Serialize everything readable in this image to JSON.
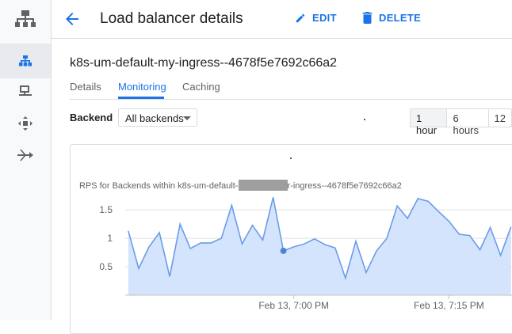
{
  "header": {
    "title": "Load balancer details",
    "edit_label": "EDIT",
    "delete_label": "DELETE"
  },
  "lb_name": "k8s-um-default-my-ingress--4678f5e7692c66a2",
  "tabs": [
    "Details",
    "Monitoring",
    "Caching"
  ],
  "active_tab": "Monitoring",
  "filters": {
    "backend_label": "Backend",
    "backend_value": "All backends"
  },
  "time_ranges": [
    "1 hour",
    "6 hours",
    "12"
  ],
  "selected_range": "1 hour",
  "rail_icons": [
    "network-services-icon",
    "load-balancing-icon",
    "backends-icon",
    "cloud-dns-icon",
    "cloud-nat-icon"
  ],
  "colors": {
    "accent": "#1a73e8",
    "series_line": "#6b9ce8",
    "series_fill": "#d2e3fc"
  },
  "chart_data": {
    "type": "area",
    "title_prefix": "RPS for Backends within k8s-um-default-",
    "title_suffix": "r-ingress--4678f5e7692c66a2",
    "xlabel": "",
    "ylabel": "",
    "yticks": [
      "1.5",
      "1",
      "0.5"
    ],
    "ylim": [
      0,
      1.85
    ],
    "xticks": [
      {
        "label": "Feb 13, 7:00 PM",
        "x": 9
      },
      {
        "label": "Feb 13, 7:15 PM",
        "x": 24
      }
    ],
    "xlim": [
      -7.3,
      30.1
    ],
    "grid": true,
    "series": [
      {
        "x": [
          -7,
          -6,
          -5,
          -4,
          -3,
          -2,
          -1,
          0,
          1,
          2,
          3,
          4,
          5,
          6,
          7,
          8,
          9,
          10,
          11,
          12,
          13,
          14,
          15,
          16,
          17,
          18,
          19,
          20,
          21,
          22,
          23,
          24,
          25,
          26,
          27,
          28,
          29,
          30
        ],
        "values": [
          1.13,
          0.47,
          0.85,
          1.1,
          0.33,
          1.25,
          0.82,
          0.92,
          0.92,
          1.0,
          1.58,
          0.9,
          1.23,
          0.97,
          1.72,
          0.78,
          0.85,
          0.9,
          0.99,
          0.89,
          0.83,
          0.3,
          0.95,
          0.4,
          0.78,
          1.0,
          1.57,
          1.35,
          1.7,
          1.65,
          1.47,
          1.3,
          1.07,
          1.05,
          0.8,
          1.19,
          0.7,
          1.2
        ]
      }
    ],
    "highlight_point": {
      "x": 8,
      "y": 0.78
    }
  }
}
